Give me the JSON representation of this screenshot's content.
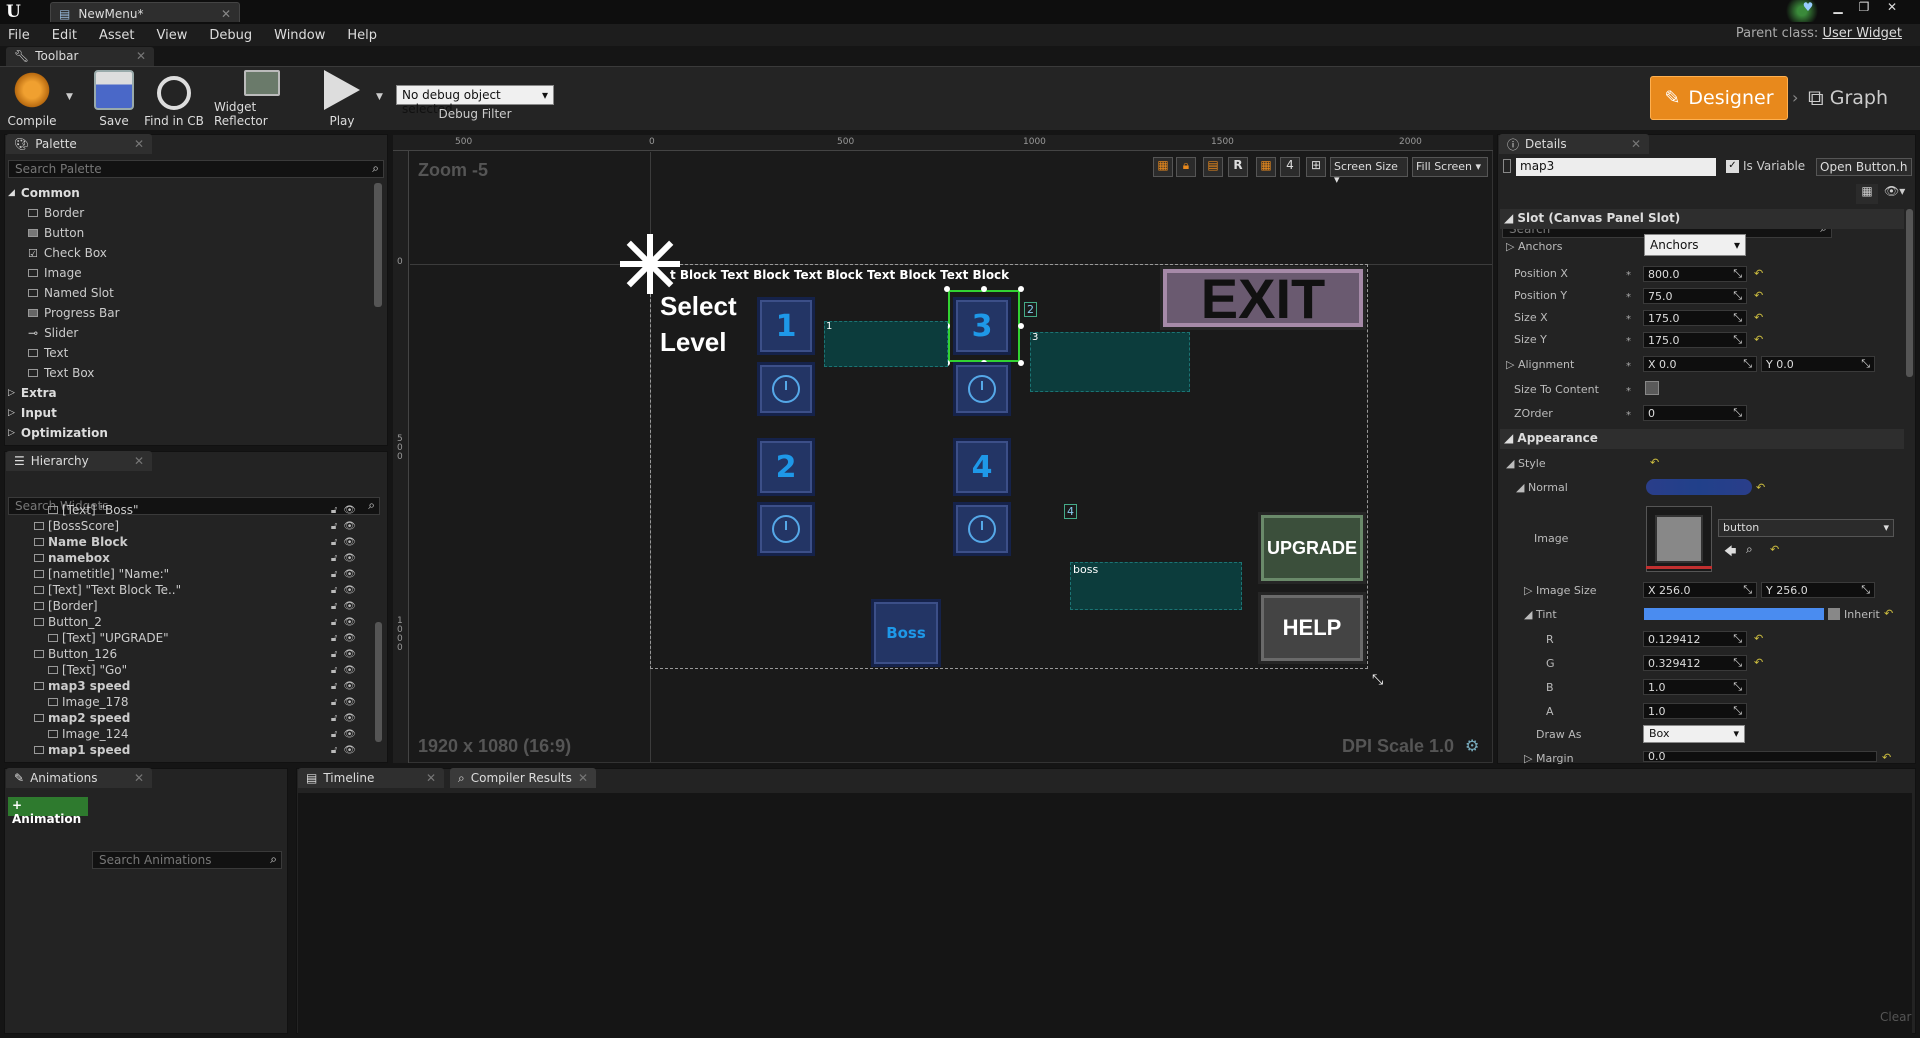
{
  "window": {
    "tab_title": "NewMenu*",
    "logo": "U"
  },
  "menu": [
    "File",
    "Edit",
    "Asset",
    "View",
    "Debug",
    "Window",
    "Help"
  ],
  "parent_class": {
    "label": "Parent class:",
    "value": "User Widget"
  },
  "toolbar": {
    "tab": "Toolbar",
    "tools": [
      {
        "label": "Compile",
        "icon": "gear-compile-icon"
      },
      {
        "label": "Save",
        "icon": "save-icon"
      },
      {
        "label": "Find in CB",
        "icon": "magnifier-icon"
      },
      {
        "label": "Widget Reflector",
        "icon": "reflector-icon"
      },
      {
        "label": "Play",
        "icon": "play-icon"
      }
    ],
    "debug_select": "No debug object selected",
    "debug_label": "Debug Filter",
    "designer": "Designer",
    "graph": "Graph"
  },
  "palette": {
    "tab": "Palette",
    "search_placeholder": "Search Palette",
    "common_label": "Common",
    "common_items": [
      "Border",
      "Button",
      "Check Box",
      "Image",
      "Named Slot",
      "Progress Bar",
      "Slider",
      "Text",
      "Text Box"
    ],
    "categories": [
      "Extra",
      "Input",
      "Optimization"
    ]
  },
  "hierarchy": {
    "tab": "Hierarchy",
    "search_placeholder": "Search Widgets",
    "items": [
      {
        "label": "[Text] \"Boss\"",
        "indent": 2,
        "bold": false
      },
      {
        "label": "[BossScore]",
        "indent": 1,
        "bold": false
      },
      {
        "label": "Name Block",
        "indent": 1,
        "bold": true
      },
      {
        "label": "namebox",
        "indent": 1,
        "bold": true
      },
      {
        "label": "[nametitle] \"Name:\"",
        "indent": 1,
        "bold": false
      },
      {
        "label": "[Text] \"Text Block Te..\"",
        "indent": 1,
        "bold": false
      },
      {
        "label": "[Border]",
        "indent": 1,
        "bold": false
      },
      {
        "label": "Button_2",
        "indent": 1,
        "bold": false
      },
      {
        "label": "[Text] \"UPGRADE\"",
        "indent": 2,
        "bold": false
      },
      {
        "label": "Button_126",
        "indent": 1,
        "bold": false
      },
      {
        "label": "[Text] \"Go\"",
        "indent": 2,
        "bold": false
      },
      {
        "label": "map3 speed",
        "indent": 1,
        "bold": true
      },
      {
        "label": "Image_178",
        "indent": 2,
        "bold": false
      },
      {
        "label": "map2 speed",
        "indent": 1,
        "bold": true
      },
      {
        "label": "Image_124",
        "indent": 2,
        "bold": false
      },
      {
        "label": "map1 speed",
        "indent": 1,
        "bold": true
      }
    ]
  },
  "viewport": {
    "zoom": "Zoom -5",
    "resolution": "1920 x 1080 (16:9)",
    "dpi": "DPI Scale 1.0",
    "screen_size": "Screen Size",
    "fill_screen": "Fill Screen",
    "r_label": "R",
    "grid_num": "4",
    "ruler_top": [
      "500",
      "0",
      "500",
      "1000",
      "1500",
      "2000"
    ],
    "ruler_left": [
      "0",
      "5\n0\n0",
      "1\n0\n0\n0"
    ],
    "text_blocks": "t Block Text Block Text Block Text Block Text Block",
    "select_level": "Select\nLevel",
    "buttons": [
      "1",
      "3",
      "2",
      "4"
    ],
    "boss_button": "Boss",
    "exit": "EXIT",
    "upgrade": "UPGRADE",
    "help": "HELP",
    "box_labels": [
      "1",
      "2",
      "3",
      "4",
      "boss"
    ]
  },
  "details": {
    "tab": "Details",
    "name": "map3",
    "is_variable": "Is Variable",
    "open_link": "Open Button.h",
    "search_placeholder": "Search",
    "slot_header": "Slot (Canvas Panel Slot)",
    "anchors_label": "Anchors",
    "anchors_value": "Anchors",
    "props": [
      {
        "label": "Position X",
        "value": "800.0"
      },
      {
        "label": "Position Y",
        "value": "75.0"
      },
      {
        "label": "Size X",
        "value": "175.0"
      },
      {
        "label": "Size Y",
        "value": "175.0"
      }
    ],
    "alignment": {
      "label": "Alignment",
      "x": "X 0.0",
      "y": "Y 0.0"
    },
    "size_to_content": "Size To Content",
    "zorder": {
      "label": "ZOrder",
      "value": "0"
    },
    "appearance": "Appearance",
    "style": "Style",
    "normal": "Normal",
    "image_label": "Image",
    "image_value": "button",
    "image_size": {
      "label": "Image Size",
      "x": "X 256.0",
      "y": "Y 256.0"
    },
    "tint": {
      "label": "Tint",
      "inherit": "Inherit"
    },
    "rgba": [
      {
        "label": "R",
        "value": "0.129412"
      },
      {
        "label": "G",
        "value": "0.329412"
      },
      {
        "label": "B",
        "value": "1.0"
      },
      {
        "label": "A",
        "value": "1.0"
      }
    ],
    "draw_as": {
      "label": "Draw As",
      "value": "Box"
    },
    "margin": {
      "label": "Margin",
      "value": "0.0"
    }
  },
  "bottom": {
    "animations_tab": "Animations",
    "add_animation": "+ Animation",
    "search_animations": "Search Animations",
    "timeline_tab": "Timeline",
    "compiler_tab": "Compiler Results",
    "clear": "Clear"
  }
}
